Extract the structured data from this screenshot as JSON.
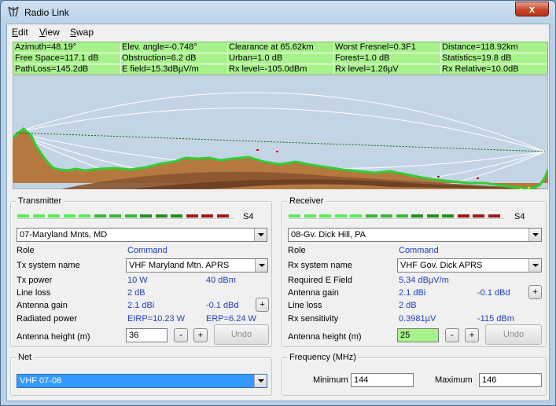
{
  "window": {
    "title": "Radio Link",
    "close_glyph": "x"
  },
  "menu": {
    "items": [
      {
        "label": "Edit",
        "accel": "E",
        "rest": "dit"
      },
      {
        "label": "View",
        "accel": "V",
        "rest": "iew"
      },
      {
        "label": "Swap",
        "accel": "S",
        "rest": "wap"
      }
    ]
  },
  "stats": {
    "rows": [
      [
        "Azimuth=48.19°",
        "Elev. angle=-0.748°",
        "Clearance at 65.62km",
        "Worst Fresnel=0.3F1",
        "Distance=118.92km"
      ],
      [
        "Free Space=117.1 dB",
        "Obstruction=6.2 dB",
        "Urban=1.0 dB",
        "Forest=1.0 dB",
        "Statistics=19.8 dB"
      ],
      [
        "PathLoss=145.2dB",
        "E field=15.3dBµV/m",
        "Rx level=-105.0dBm",
        "Rx level=1.26µV",
        "Rx Relative=10.0dB"
      ]
    ],
    "background_color": "#a8f28c"
  },
  "profile": {
    "sky_color": "#ffffff",
    "terrain_color": "#b5793f",
    "vegetation_color": "#33cc33",
    "fresnel_color": "#ffffff",
    "line_of_sight_color": "#006600"
  },
  "transmitter": {
    "group_label": "Transmitter",
    "signal_label": "S4",
    "site": "07-Maryland Mnts, MD",
    "role_label": "Role",
    "role_value": "Command",
    "system_label": "Tx system name",
    "system_value": "VHF Maryland Mtn. APRS",
    "power_label": "Tx power",
    "power_w": "10 W",
    "power_dbm": "40 dBm",
    "line_loss_label": "Line loss",
    "line_loss": "2 dB",
    "gain_label": "Antenna gain",
    "gain_dbi": "2.1 dBi",
    "gain_dbd": "-0.1 dBd",
    "plus": "+",
    "radiated_label": "Radiated power",
    "eirp": "EIRP=10.23 W",
    "erp": "ERP=6.24 W",
    "height_label": "Antenna height (m)",
    "height": "36",
    "minus": "-",
    "undo": "Undo"
  },
  "receiver": {
    "group_label": "Receiver",
    "signal_label": "S4",
    "site": "08-Gv. Dick Hill, PA",
    "role_label": "Role",
    "role_value": "Command",
    "system_label": "Rx system name",
    "system_value": "VHF Gov. Dick APRS",
    "required_label": "Required E Field",
    "required_value": "5.34 dBµV/m",
    "gain_label": "Antenna gain",
    "gain_dbi": "2.1 dBi",
    "gain_dbd": "-0.1 dBd",
    "plus": "+",
    "line_loss_label": "Line loss",
    "line_loss": "2 dB",
    "sensitivity_label": "Rx sensitivity",
    "sensitivity_uv": "0.3981µV",
    "sensitivity_dbm": "-115 dBm",
    "height_label": "Antenna height (m)",
    "height": "25",
    "minus": "-",
    "undo": "Undo"
  },
  "net": {
    "group_label": "Net",
    "value": "VHF 07-08"
  },
  "frequency": {
    "group_label": "Frequency (MHz)",
    "min_label": "Minimum",
    "min_value": "144",
    "max_label": "Maximum",
    "max_value": "146"
  },
  "meter_colors": [
    "#55ee55",
    "#55ee55",
    "#55ee55",
    "#55ee55",
    "#55ee55",
    "#33bb33",
    "#33bb33",
    "#33bb33",
    "#1f8f1f",
    "#1f8f1f",
    "#1f8f1f",
    "#a01818",
    "#a01818",
    "#a01818"
  ]
}
